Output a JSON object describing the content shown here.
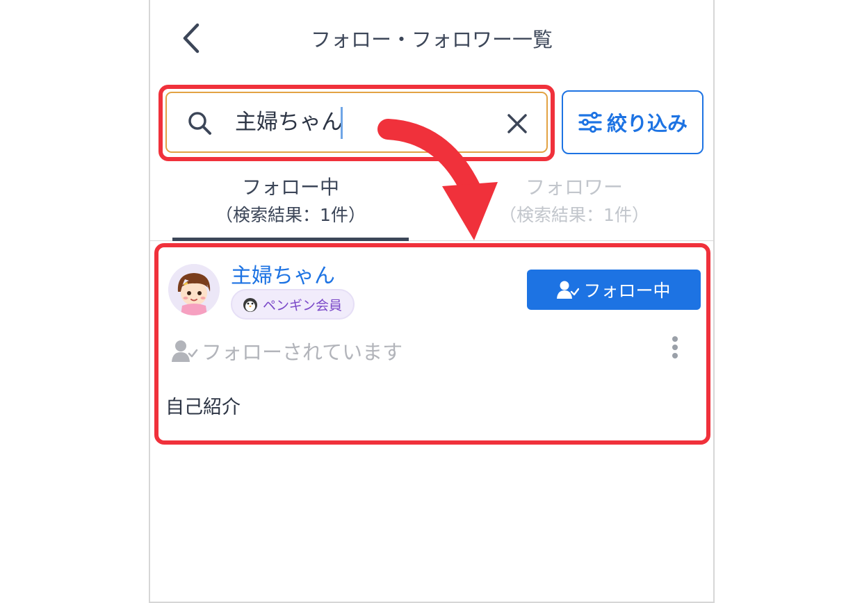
{
  "header": {
    "title": "フォロー・フォロワー一覧",
    "back_icon": "chevron-left-icon"
  },
  "search": {
    "value": "主婦ちゃん",
    "search_icon": "search-icon",
    "clear_icon": "close-icon",
    "highlight_color": "#f0313b"
  },
  "filter": {
    "label": "絞り込み",
    "icon": "sliders-icon"
  },
  "tabs": [
    {
      "label": "フォロー中",
      "sublabel": "（検索結果：1件）",
      "active": true
    },
    {
      "label": "フォロワー",
      "sublabel": "（検索結果：1件）",
      "active": false
    }
  ],
  "result": {
    "name": "主婦ちゃん",
    "badge_label": "ペンギン会員",
    "badge_icon": "penguin-icon",
    "follow_button_label": "フォロー中",
    "follow_button_icon": "user-check-icon",
    "followed_status": "フォローされています",
    "bio_label": "自己紹介"
  },
  "colors": {
    "accent": "#1d73e3",
    "annotation_red": "#f0313b",
    "text_dark": "#3c4658",
    "inactive": "#c2c6cc"
  }
}
